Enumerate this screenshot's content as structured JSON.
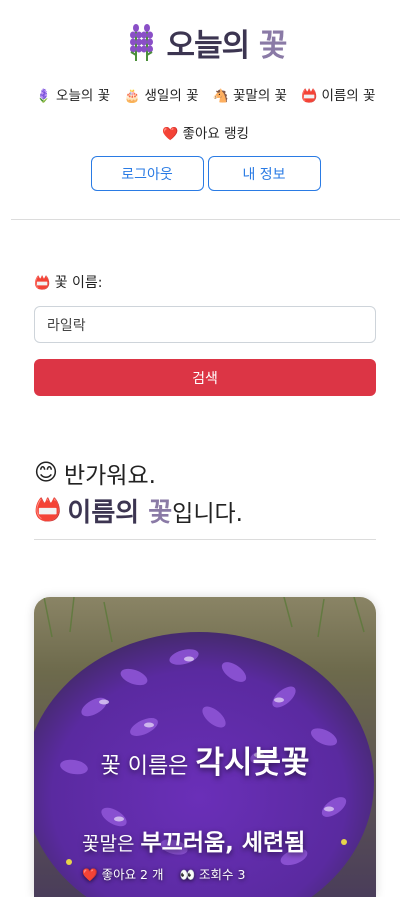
{
  "header": {
    "logo_icon": "lavender-icon",
    "title_dark": "오늘의",
    "title_light": "꽃"
  },
  "nav": [
    {
      "icon": "🪻",
      "label": "오늘의 꽃"
    },
    {
      "icon": "🎂",
      "label": "생일의 꽃"
    },
    {
      "icon": "🐴",
      "label": "꽃말의 꽃"
    },
    {
      "icon": "📛",
      "label": "이름의 꽃"
    },
    {
      "icon": "❤️",
      "label": "좋아요 랭킹"
    }
  ],
  "auth": {
    "logout_label": "로그아웃",
    "myinfo_label": "내 정보"
  },
  "search": {
    "label_icon": "📛",
    "label": "꽃 이름:",
    "value": "라일락",
    "button_label": "검색"
  },
  "welcome": {
    "icon1": "😊",
    "line1": "반가워요.",
    "icon2": "📛",
    "title_dark": "이름의",
    "title_light": "꽃",
    "suffix": "입니다."
  },
  "card": {
    "name_prefix": "꽃 이름은",
    "name": "각시붓꽃",
    "meaning_prefix": "꽃말은",
    "meaning": "부끄러움, 세련됨",
    "likes_icon": "❤️",
    "likes_text": "좋아요 2 개",
    "views_icon": "👀",
    "views_text": "조회수 3"
  },
  "colors": {
    "accent_blue": "#2a7be4",
    "danger_red": "#dc3545",
    "title_dark": "#3c3551",
    "title_light": "#8a7aa6"
  }
}
